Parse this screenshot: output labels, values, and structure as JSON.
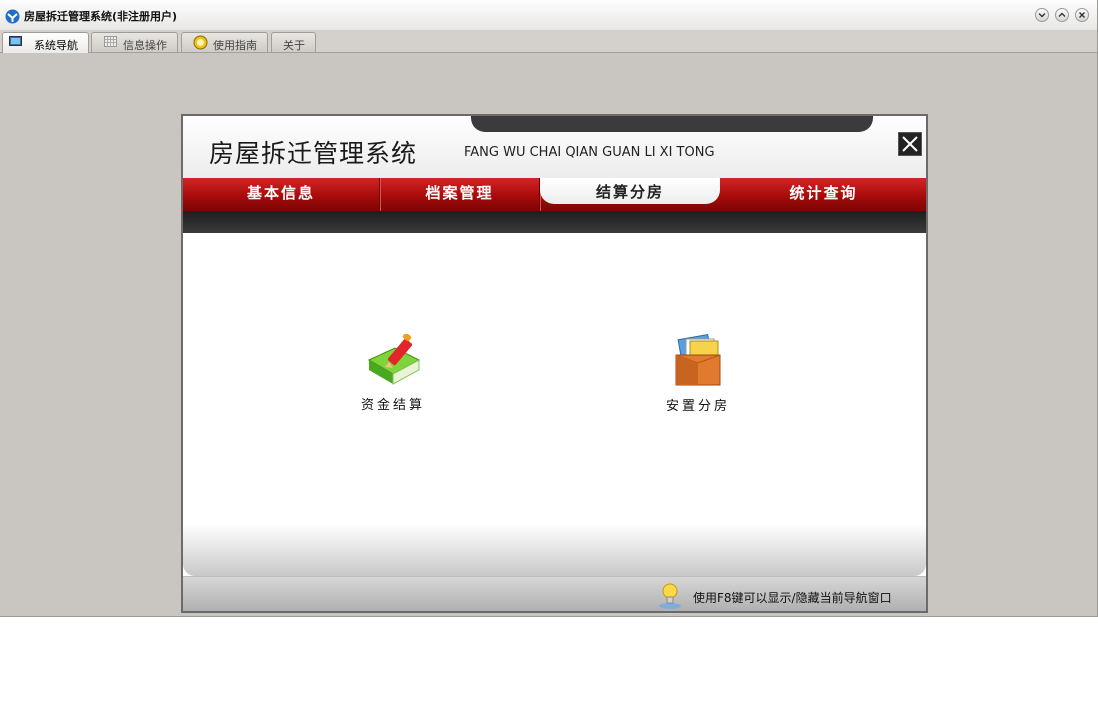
{
  "window": {
    "title": "房屋拆迁管理系统(非注册用户)"
  },
  "tabs": [
    {
      "label": "系统导航",
      "icon": "monitor-icon",
      "active": true
    },
    {
      "label": "信息操作",
      "icon": "grid-icon",
      "active": false
    },
    {
      "label": "使用指南",
      "icon": "help-icon",
      "active": false
    },
    {
      "label": "关于",
      "icon": "",
      "active": false
    }
  ],
  "panel": {
    "title": "房屋拆迁管理系统",
    "subtitle": "FANG WU CHAI QIAN GUAN LI XI TONG",
    "nav": [
      {
        "label": "基本信息",
        "active": false
      },
      {
        "label": "档案管理",
        "active": false
      },
      {
        "label": "结算分房",
        "active": true
      },
      {
        "label": "统计查询",
        "active": false
      }
    ],
    "items": [
      {
        "label": "资金结算",
        "icon": "book-pencil-icon"
      },
      {
        "label": "安置分房",
        "icon": "file-box-icon"
      }
    ],
    "footer_tip": "使用F8键可以显示/隐藏当前导航窗口"
  },
  "colors": {
    "nav_red": "#b01010",
    "window_bg": "#c9c5c1"
  }
}
